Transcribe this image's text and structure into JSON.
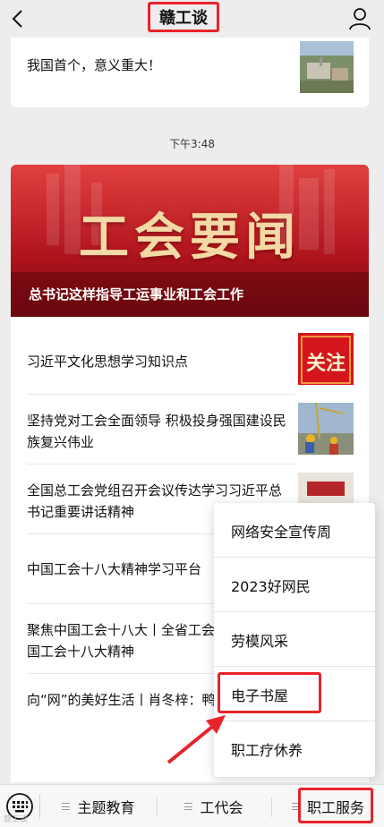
{
  "header": {
    "title": "赣工谈",
    "back_icon": "chevron-left-icon",
    "profile_icon": "person-icon"
  },
  "previous_message": {
    "text": "我国首个，意义重大！"
  },
  "timestamp": "下午3:48",
  "article": {
    "banner_title": "工会要闻",
    "banner_headline": "总书记这样指导工运事业和工会工作",
    "items": [
      {
        "text": "习近平文化思想学习知识点",
        "thumb_label": "关注"
      },
      {
        "text": "坚持党对工会全面领导 积极投身强国建设民族复兴伟业"
      },
      {
        "text": "全国总工会党组召开会议传达学习习近平总书记重要讲话精神"
      },
      {
        "text": "中国工会十八大精神学习平台"
      },
      {
        "text": "聚焦中国工会十八大丨全省工会宣传贯彻中国工会十八大精神"
      },
      {
        "text": "向“网”的美好生活丨肖冬梓：鸭司令”"
      }
    ]
  },
  "popup_menu": {
    "items": [
      {
        "label": "网络安全宣传周"
      },
      {
        "label": "2023好网民"
      },
      {
        "label": "劳模风采"
      },
      {
        "label": "电子书屋"
      },
      {
        "label": "职工疗休养"
      }
    ]
  },
  "bottom_bar": {
    "keyboard_icon": "keyboard-icon",
    "tabs": [
      {
        "label": "主题教育"
      },
      {
        "label": "工代会"
      },
      {
        "label": "职工服务"
      }
    ]
  },
  "watermark": "赣工谈",
  "colors": {
    "annotation_red": "#e8232a",
    "banner_red": "#b0141c",
    "background": "#ededed"
  }
}
